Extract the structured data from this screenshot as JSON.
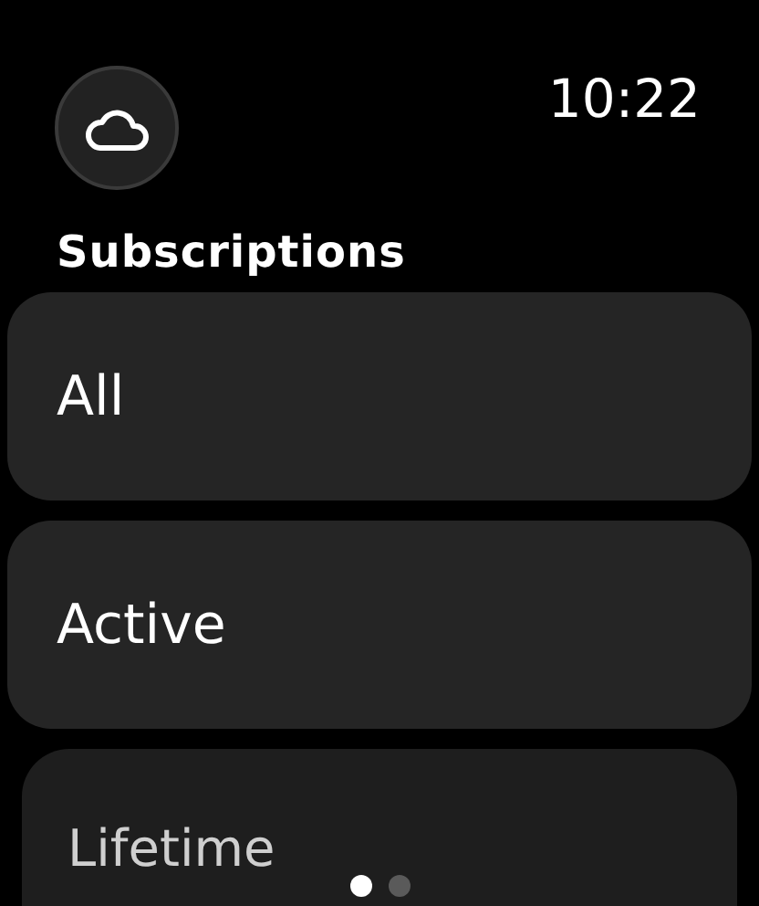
{
  "time": "10:22",
  "title": "Subscriptions",
  "items": [
    {
      "label": "All",
      "faded": false
    },
    {
      "label": "Active",
      "faded": false
    },
    {
      "label": "Lifetime",
      "faded": true
    }
  ],
  "page_dots": [
    {
      "selected": true
    },
    {
      "selected": false
    }
  ]
}
